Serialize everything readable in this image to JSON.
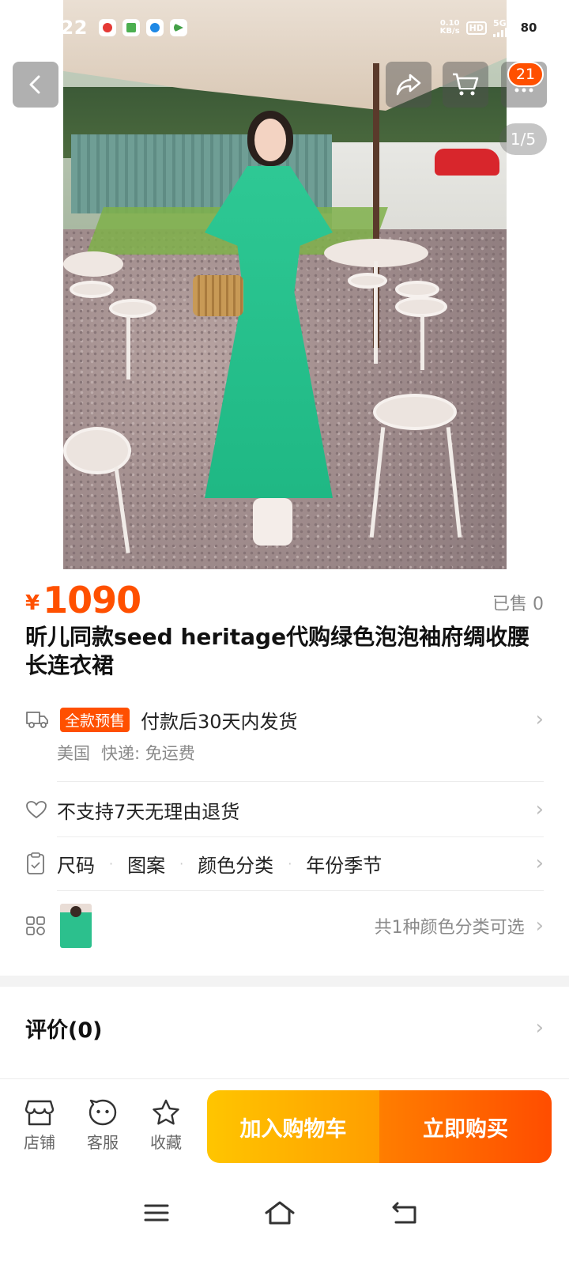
{
  "status_bar": {
    "time": "14:22",
    "net_speed_value": "0.10",
    "net_speed_unit": "KB/s",
    "hd": "HD",
    "signal": "5G",
    "battery": "80"
  },
  "gallery": {
    "cart_count": "21",
    "counter": "1/5"
  },
  "product": {
    "currency": "¥",
    "price": "1090",
    "sold": "已售 0",
    "title": "昕儿同款seed heritage代购绿色泡泡袖府绸收腰长连衣裙"
  },
  "shipping": {
    "badge": "全款预售",
    "text": "付款后30天内发货",
    "origin": "美国",
    "express": "快递: 免运费"
  },
  "return_policy": "不支持7天无理由退货",
  "specs": [
    "尺码",
    "图案",
    "颜色分类",
    "年份季节"
  ],
  "variants": {
    "summary": "共1种颜色分类可选"
  },
  "reviews": {
    "title": "评价(0)"
  },
  "action_bar": {
    "store": "店铺",
    "service": "客服",
    "favorite": "收藏",
    "add_to_cart": "加入购物车",
    "buy_now": "立即购买"
  },
  "colors": {
    "accent": "#ff5000",
    "cart_button": "#ffb300",
    "buy_button": "#ff5a00"
  }
}
